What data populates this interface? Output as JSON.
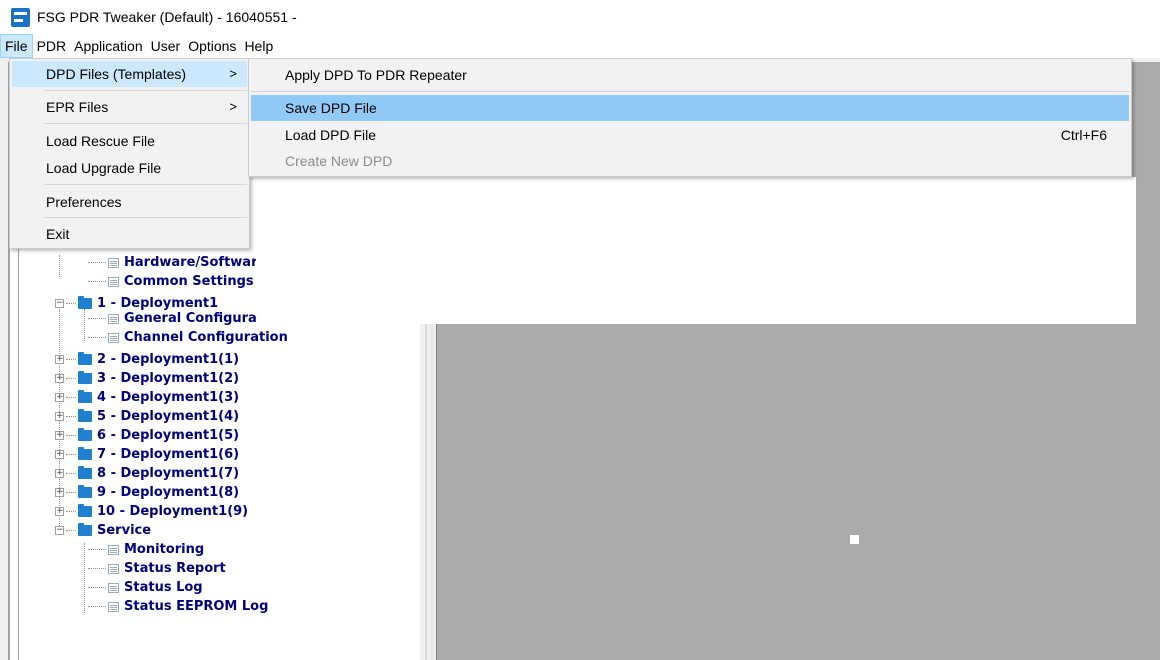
{
  "window": {
    "title": "FSG PDR Tweaker (Default) - 16040551 -"
  },
  "menubar": [
    "File",
    "PDR",
    "Application",
    "User",
    "Options",
    "Help"
  ],
  "file_menu": {
    "items": [
      "DPD Files (Templates)",
      "EPR Files",
      "Load Rescue File",
      "Load Upgrade File",
      "Preferences",
      "Exit"
    ],
    "submenu_arrow": ">"
  },
  "dpd_submenu": {
    "items": [
      "Apply DPD To PDR Repeater",
      "Save DPD File",
      "Load DPD File",
      "Create New DPD"
    ],
    "shortcut_load": "Ctrl+F6"
  },
  "tree": {
    "collapse_glyph": "−",
    "expand_glyph": "+",
    "leaf_hw": "Hardware/Softwar",
    "leaf_common": "Common Settings",
    "node_dep1": "1 - Deployment1",
    "leaf_general": "General Configurat.",
    "leaf_channel": "Channel Configuration",
    "nodes": [
      "2 - Deployment1(1)",
      "3 - Deployment1(2)",
      "4 - Deployment1(3)",
      "5 - Deployment1(4)",
      "6 - Deployment1(5)",
      "7 - Deployment1(6)",
      "8 - Deployment1(7)",
      "9 - Deployment1(8)",
      "10 - Deployment1(9)"
    ],
    "service": "Service",
    "service_items": [
      "Monitoring",
      "Status Report",
      "Status Log",
      "Status EEPROM Log"
    ]
  }
}
